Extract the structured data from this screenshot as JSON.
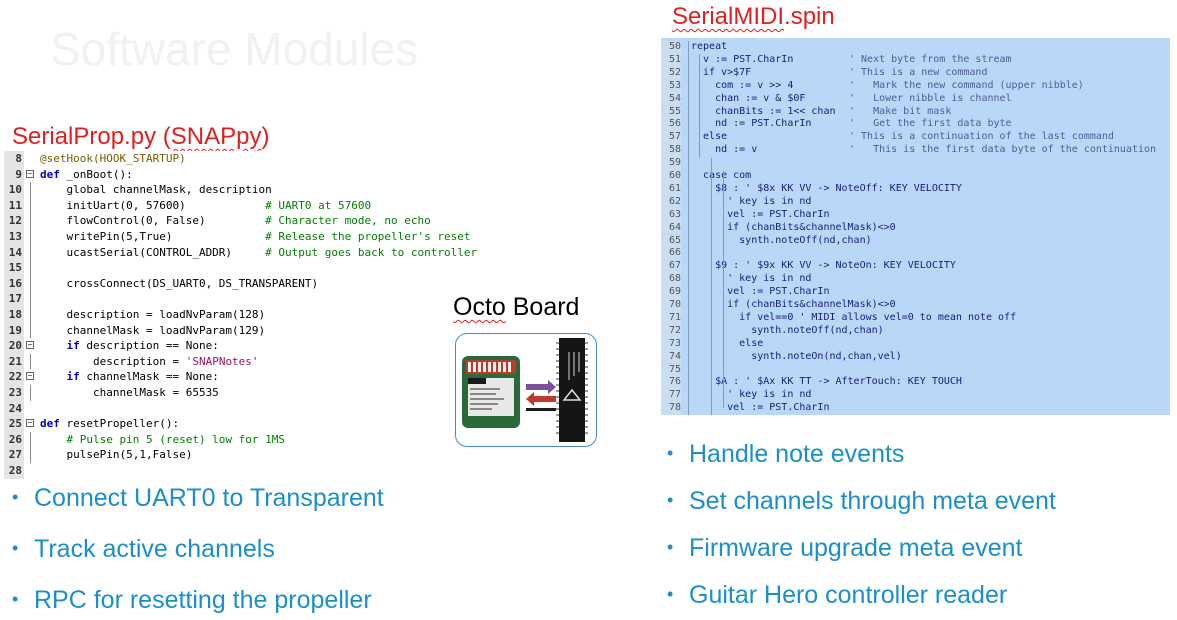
{
  "ghost_title": "Software Modules",
  "left": {
    "title_normal": "SerialProp.py (",
    "title_squiggle": "SNAPpy",
    "title_close": ")",
    "code_lines": [
      {
        "n": "8",
        "fold": "",
        "parts": [
          [
            "dec",
            "@setHook(HOOK_STARTUP)"
          ]
        ]
      },
      {
        "n": "9",
        "fold": "box",
        "parts": [
          [
            "kw",
            "def"
          ],
          [
            "nm",
            " _onBoot():"
          ]
        ]
      },
      {
        "n": "10",
        "fold": "line",
        "parts": [
          [
            "nm",
            "    global channelMask, description"
          ]
        ]
      },
      {
        "n": "11",
        "fold": "line",
        "parts": [
          [
            "nm",
            "    initUart(0, 57600)            "
          ],
          [
            "cm",
            "# UART0 at 57600"
          ]
        ]
      },
      {
        "n": "12",
        "fold": "line",
        "parts": [
          [
            "nm",
            "    flowControl(0, False)         "
          ],
          [
            "cm",
            "# Character mode, no echo"
          ]
        ]
      },
      {
        "n": "13",
        "fold": "line",
        "parts": [
          [
            "nm",
            "    writePin(5,True)              "
          ],
          [
            "cm",
            "# Release the propeller's reset"
          ]
        ]
      },
      {
        "n": "14",
        "fold": "line",
        "parts": [
          [
            "nm",
            "    ucastSerial(CONTROL_ADDR)     "
          ],
          [
            "cm",
            "# Output goes back to controller"
          ]
        ]
      },
      {
        "n": "15",
        "fold": "line",
        "parts": [
          [
            "nm",
            ""
          ]
        ]
      },
      {
        "n": "16",
        "fold": "line",
        "parts": [
          [
            "nm",
            "    crossConnect(DS_UART0, DS_TRANSPARENT)"
          ]
        ]
      },
      {
        "n": "17",
        "fold": "line",
        "parts": [
          [
            "nm",
            ""
          ]
        ]
      },
      {
        "n": "18",
        "fold": "line",
        "parts": [
          [
            "nm",
            "    description = loadNvParam(128)"
          ]
        ]
      },
      {
        "n": "19",
        "fold": "line",
        "parts": [
          [
            "nm",
            "    channelMask = loadNvParam(129)"
          ]
        ]
      },
      {
        "n": "20",
        "fold": "box",
        "parts": [
          [
            "kw",
            "    if"
          ],
          [
            "nm",
            " description == None:"
          ]
        ]
      },
      {
        "n": "21",
        "fold": "line",
        "parts": [
          [
            "nm",
            "        description = "
          ],
          [
            "st",
            "'SNAPNotes'"
          ]
        ]
      },
      {
        "n": "22",
        "fold": "box",
        "parts": [
          [
            "kw",
            "    if"
          ],
          [
            "nm",
            " channelMask == None:"
          ]
        ]
      },
      {
        "n": "23",
        "fold": "line",
        "parts": [
          [
            "nm",
            "        channelMask = 65535"
          ]
        ]
      },
      {
        "n": "24",
        "fold": "",
        "parts": [
          [
            "nm",
            ""
          ]
        ]
      },
      {
        "n": "25",
        "fold": "box",
        "parts": [
          [
            "kw",
            "def"
          ],
          [
            "nm",
            " resetPropeller():"
          ]
        ]
      },
      {
        "n": "26",
        "fold": "line",
        "parts": [
          [
            "cm",
            "    # Pulse pin 5 (reset) low for 1MS"
          ]
        ]
      },
      {
        "n": "27",
        "fold": "line",
        "parts": [
          [
            "nm",
            "    pulsePin(5,1,False)"
          ]
        ]
      },
      {
        "n": "28",
        "fold": "",
        "parts": [
          [
            "nm",
            ""
          ]
        ]
      }
    ],
    "bullets": [
      "Connect UART0 to Transparent",
      "Track active channels",
      "RPC for resetting the propeller"
    ]
  },
  "octo": {
    "title_squiggle": "Octo",
    "title_rest": " Board"
  },
  "right": {
    "title_squiggle": "SerialMIDI",
    "title_rest": ".spin",
    "code_lines": [
      {
        "n": "50",
        "code": "repeat",
        "cmt": ""
      },
      {
        "n": "51",
        "code": "  v := PST.CharIn",
        "cmt": "' Next byte from the stream"
      },
      {
        "n": "52",
        "code": "  if v>$7F",
        "cmt": "' This is a new command"
      },
      {
        "n": "53",
        "code": "    com := v >> 4",
        "cmt": "'   Mark the new command (upper nibble)"
      },
      {
        "n": "54",
        "code": "    chan := v & $0F",
        "cmt": "'   Lower nibble is channel"
      },
      {
        "n": "55",
        "code": "    chanBits := 1<< chan",
        "cmt": "'   Make bit mask"
      },
      {
        "n": "56",
        "code": "    nd := PST.CharIn",
        "cmt": "'   Get the first data byte"
      },
      {
        "n": "57",
        "code": "  else",
        "cmt": "' This is a continuation of the last command"
      },
      {
        "n": "58",
        "code": "    nd := v",
        "cmt": "'   This is the first data byte of the continuation"
      },
      {
        "n": "59",
        "code": "",
        "cmt": ""
      },
      {
        "n": "60",
        "code": "  case com",
        "cmt": ""
      },
      {
        "n": "61",
        "code": "    $8 : ' $8x KK VV -> NoteOff: KEY VELOCITY",
        "cmt": ""
      },
      {
        "n": "62",
        "code": "      ' key is in nd",
        "cmt": ""
      },
      {
        "n": "63",
        "code": "      vel := PST.CharIn",
        "cmt": ""
      },
      {
        "n": "64",
        "code": "      if (chanBits&channelMask)<>0",
        "cmt": ""
      },
      {
        "n": "65",
        "code": "        synth.noteOff(nd,chan)",
        "cmt": ""
      },
      {
        "n": "66",
        "code": "",
        "cmt": ""
      },
      {
        "n": "67",
        "code": "    $9 : ' $9x KK VV -> NoteOn: KEY VELOCITY",
        "cmt": ""
      },
      {
        "n": "68",
        "code": "      ' key is in nd",
        "cmt": ""
      },
      {
        "n": "69",
        "code": "      vel := PST.CharIn",
        "cmt": ""
      },
      {
        "n": "70",
        "code": "      if (chanBits&channelMask)<>0",
        "cmt": ""
      },
      {
        "n": "71",
        "code": "        if vel==0 ' MIDI allows vel=0 to mean note off",
        "cmt": ""
      },
      {
        "n": "72",
        "code": "          synth.noteOff(nd,chan)",
        "cmt": ""
      },
      {
        "n": "73",
        "code": "        else",
        "cmt": ""
      },
      {
        "n": "74",
        "code": "          synth.noteOn(nd,chan,vel)",
        "cmt": ""
      },
      {
        "n": "75",
        "code": "",
        "cmt": ""
      },
      {
        "n": "76",
        "code": "    $A : ' $Ax KK TT -> AfterTouch: KEY TOUCH",
        "cmt": ""
      },
      {
        "n": "77",
        "code": "      ' key is in nd",
        "cmt": ""
      },
      {
        "n": "78",
        "code": "      vel := PST.CharIn",
        "cmt": ""
      }
    ],
    "bullets": [
      "Handle note events",
      "Set channels through meta event",
      "Firmware upgrade meta event",
      "Guitar Hero controller reader"
    ]
  },
  "colors": {
    "title_red": "#e02020",
    "bullet_blue": "#1a8fc9",
    "spin_bg": "#b9d8f8"
  }
}
